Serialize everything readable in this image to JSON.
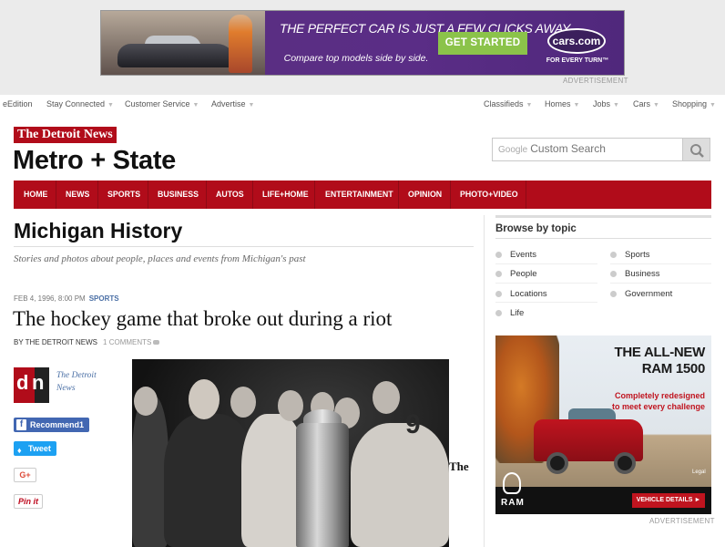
{
  "top_ad": {
    "headline": "THE PERFECT CAR IS JUST A FEW CLICKS AWAY",
    "subline": "Compare top models side by side.",
    "cta": "GET STARTED",
    "logo": "cars.com",
    "tagline": "FOR EVERY TURN™",
    "label": "ADVERTISEMENT"
  },
  "util_nav": {
    "left": [
      "eEdition",
      "Stay Connected",
      "Customer Service",
      "Advertise"
    ],
    "right": [
      "Classifieds",
      "Homes",
      "Jobs",
      "Cars",
      "Shopping"
    ]
  },
  "masthead": {
    "brand": "The Detroit News",
    "section": "Metro + State",
    "search_brand": "Google",
    "search_placeholder": "Custom Search"
  },
  "main_nav": [
    "HOME",
    "NEWS",
    "SPORTS",
    "BUSINESS",
    "AUTOS",
    "LIFE+HOME",
    "ENTERTAINMENT",
    "OPINION",
    "PHOTO+VIDEO"
  ],
  "subsection": {
    "title": "Michigan History",
    "description": "Stories and photos about people, places and events from Michigan's past"
  },
  "article": {
    "dateline": "FEB 4, 1996, 8:00 PM",
    "category": "SPORTS",
    "headline": "The hockey game that broke out during a riot",
    "byline": "BY THE DETROIT NEWS",
    "comments": "1 COMMENTS",
    "author_logo_d": "d",
    "author_logo_n": "n",
    "author": "The Detroit News",
    "photo_jersey": "9",
    "body_start": "The"
  },
  "share": {
    "facebook": "Recommend",
    "facebook_count": "1",
    "twitter": "Tweet",
    "google": "G+",
    "pinterest": "Pin it"
  },
  "sidebar": {
    "browse_title": "Browse by topic",
    "topics_left": [
      "Events",
      "People",
      "Locations",
      "Life"
    ],
    "topics_right": [
      "Sports",
      "Business",
      "Government"
    ]
  },
  "side_ad": {
    "headline": "THE ALL-NEW RAM 1500",
    "subline": "Completely redesigned to meet every challenge",
    "brand": "RAM",
    "cta": "VEHICLE DETAILS ►",
    "legal": "Legal",
    "label": "ADVERTISEMENT"
  },
  "colors": {
    "brand_red": "#b10c1a",
    "link_blue": "#4a6fa5",
    "facebook": "#4267b2",
    "twitter": "#1da1f2"
  }
}
